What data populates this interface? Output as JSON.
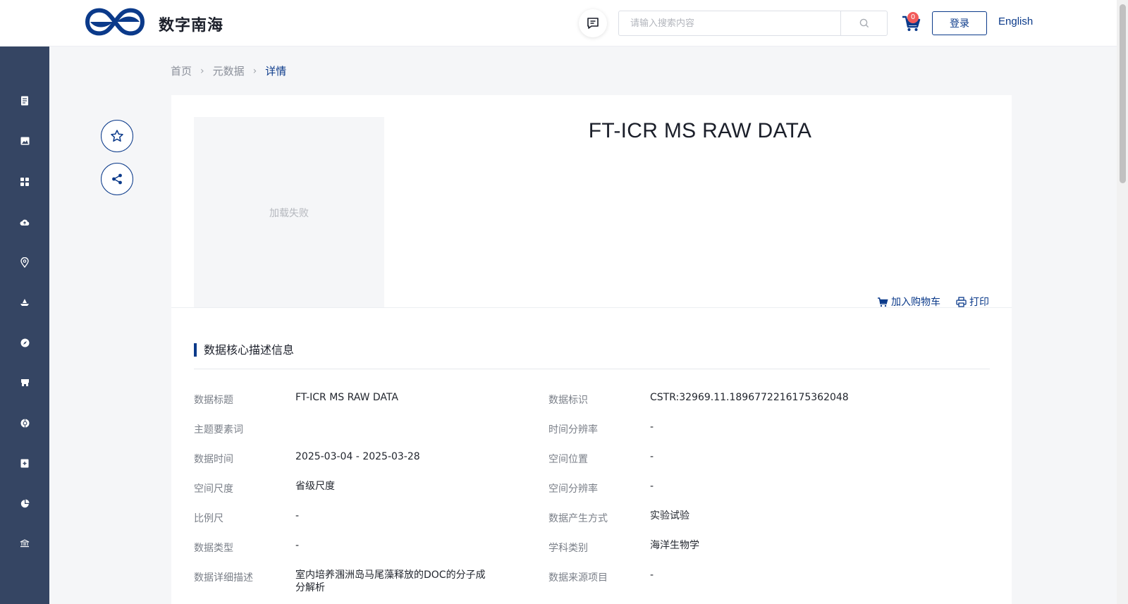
{
  "header": {
    "site_name": "数字南海",
    "search_placeholder": "请输入搜索内容",
    "cart_count": "0",
    "login_label": "登录",
    "language_label": "English"
  },
  "sidebar": {
    "icons": [
      "document-icon",
      "image-icon",
      "grid-icon",
      "cloud-upload-icon",
      "location-pin-icon",
      "ship-icon",
      "compass-icon",
      "store-icon",
      "globe-icon",
      "plus-box-icon",
      "pie-chart-icon",
      "museum-icon"
    ]
  },
  "breadcrumb": {
    "home": "首页",
    "metadata": "元数据",
    "current": "详情"
  },
  "detail": {
    "image_placeholder": "加载失败",
    "title": "FT-ICR MS RAW DATA",
    "add_to_cart": "加入购物车",
    "print": "打印"
  },
  "section": {
    "title": "数据核心描述信息"
  },
  "metadata": {
    "left": [
      {
        "label": "数据标题",
        "value": "FT-ICR MS RAW DATA"
      },
      {
        "label": "主题要素词",
        "value": ""
      },
      {
        "label": "数据时间",
        "value": "2025-03-04 - 2025-03-28"
      },
      {
        "label": "空间尺度",
        "value": "省级尺度"
      },
      {
        "label": "比例尺",
        "value": "-"
      },
      {
        "label": "数据类型",
        "value": "-"
      },
      {
        "label": "数据详细描述",
        "value": "室内培养涠洲岛马尾藻释放的DOC的分子成分解析"
      }
    ],
    "right": [
      {
        "label": "数据标识",
        "value": "CSTR:32969.11.1896772216175362048"
      },
      {
        "label": "时间分辨率",
        "value": "-"
      },
      {
        "label": "空间位置",
        "value": "-"
      },
      {
        "label": "空间分辨率",
        "value": "-"
      },
      {
        "label": "数据产生方式",
        "value": "实验试验"
      },
      {
        "label": "学科类别",
        "value": "海洋生物学"
      },
      {
        "label": "数据来源项目",
        "value": "-"
      }
    ]
  },
  "colors": {
    "primary": "#0b3a8a",
    "sidebar": "#354563",
    "badge": "#f25a5a"
  }
}
